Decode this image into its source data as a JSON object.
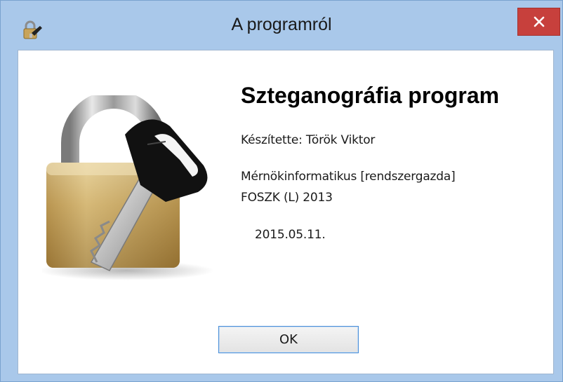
{
  "window": {
    "title": "A programról",
    "close_label": "×"
  },
  "content": {
    "heading": "Szteganográfia program",
    "author_line": "Készítette: Török Viktor",
    "course_line1": "Mérnökinformatikus [rendszergazda]",
    "course_line2": "FOSZK (L) 2013",
    "date": "2015.05.11."
  },
  "buttons": {
    "ok_label": "OK"
  },
  "icons": {
    "app": "lock-key-icon",
    "close": "close-icon",
    "illustration": "padlock-with-key-icon"
  },
  "colors": {
    "frame": "#a9c8ea",
    "close_button": "#c7403c",
    "ok_border": "#4a8fd8"
  }
}
